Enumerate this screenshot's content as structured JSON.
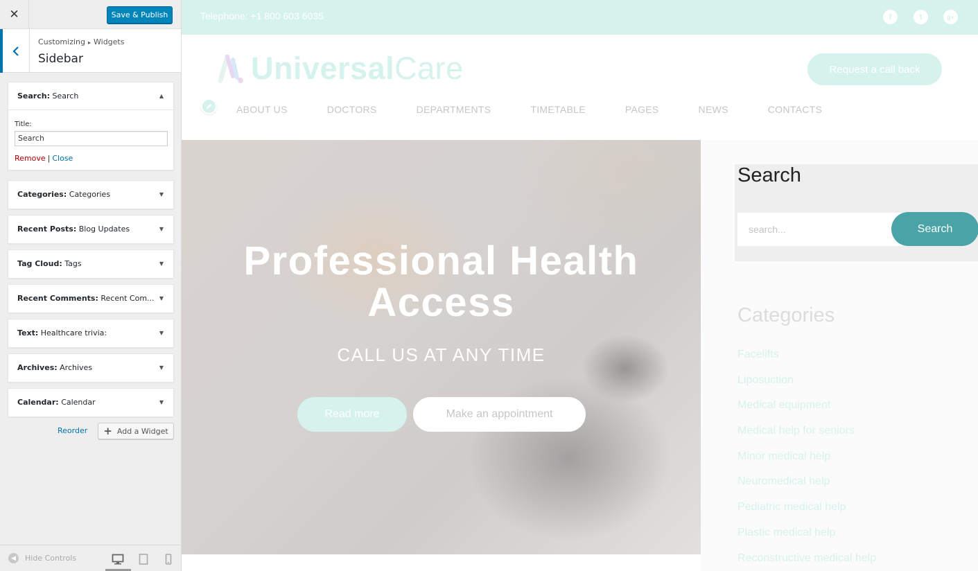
{
  "customizer": {
    "close_label": "✕",
    "save_label": "Save & Publish",
    "breadcrumb": {
      "root": "Customizing",
      "separator": "▸",
      "child": "Widgets"
    },
    "section_title": "Sidebar",
    "widgets": [
      {
        "type": "Search",
        "title": "Search",
        "expanded": true
      },
      {
        "type": "Categories",
        "title": "Categories"
      },
      {
        "type": "Recent Posts",
        "title": "Blog Updates"
      },
      {
        "type": "Tag Cloud",
        "title": "Tags"
      },
      {
        "type": "Recent Comments",
        "title": "Recent Com..."
      },
      {
        "type": "Text",
        "title": "Healthcare trivia:"
      },
      {
        "type": "Archives",
        "title": "Archives"
      },
      {
        "type": "Calendar",
        "title": "Calendar"
      }
    ],
    "search_widget_form": {
      "title_label": "Title:",
      "title_value": "Search",
      "remove_label": "Remove",
      "separator": "|",
      "close_label": "Close"
    },
    "reorder_label": "Reorder",
    "add_widget_label": "Add a Widget",
    "hide_controls_label": "Hide Controls",
    "active_device": "desktop"
  },
  "site": {
    "topbar": {
      "phone": "Telephone: +1 800 603 6035",
      "social": [
        "f",
        "t",
        "g+"
      ]
    },
    "logo": {
      "part1": "Universal",
      "part2": "Care"
    },
    "callback_label": "Request a call back",
    "nav": [
      "ABOUT US",
      "DOCTORS",
      "DEPARTMENTS",
      "TIMETABLE",
      "PAGES",
      "NEWS",
      "CONTACTS"
    ],
    "hero": {
      "title_line1": "Professional Health",
      "title_line2": "Access",
      "subtitle": "CALL US AT ANY TIME",
      "read_more": "Read more",
      "appointment": "Make an appointment"
    },
    "sidebar": {
      "search_title": "Search",
      "search_placeholder": "search...",
      "search_button": "Search",
      "categories_title": "Categories",
      "categories": [
        "Facelifts",
        "Liposuction",
        "Medical equipment",
        "Medical help for seniors",
        "Minor medical help",
        "Neuromedical help",
        "Pediatric medical help",
        "Plastic medical help",
        "Reconstructive medical help"
      ]
    }
  },
  "colors": {
    "accent": "#0085ba",
    "mint": "#d6f2ec",
    "teal": "#4aa3a6",
    "remove": "#aa0000"
  }
}
